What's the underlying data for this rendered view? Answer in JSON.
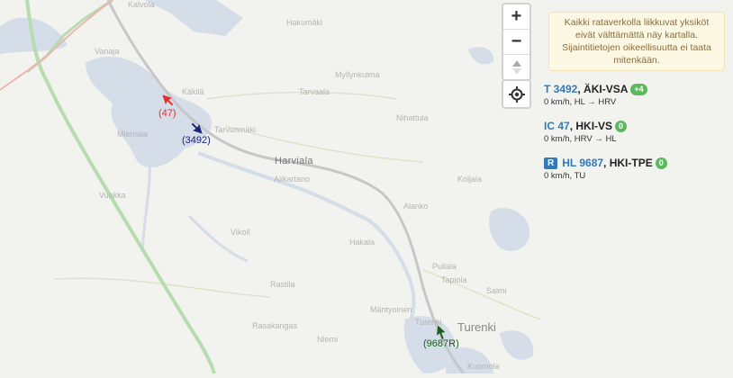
{
  "map": {
    "places": {
      "kalvola": "Kalvola",
      "hakumaki": "Hakumäki",
      "vanaja": "Vanaja",
      "mylly": "Myllynkulma",
      "kakila": "Käkilä",
      "tarvaala": "Tarvaala",
      "nihattula": "Nihattula",
      "miemala": "Miemala",
      "tarvunmaki": "Tarvunmäki",
      "harviala": "Harviala",
      "alikartano": "Alikartano",
      "koljala": "Koljala",
      "alanko": "Alanko",
      "pullala": "Pullala",
      "tapiola": "Tapiola",
      "rastila": "Rastila",
      "rasakangas": "Rasakangas",
      "mantyoinen": "Mäntyoinen",
      "turenki": "Turenki",
      "turenki_small": "Turenki",
      "kuomola": "Kuomola",
      "vikoll": "Vikoll",
      "hakala": "Hakala",
      "vuokka": "Vuokka",
      "salmi": "Salmi",
      "niemi": "Niemi"
    },
    "markers": [
      {
        "label": "(47)",
        "color": "#e03030"
      },
      {
        "label": "(3492)",
        "color": "#1a237e"
      },
      {
        "label": "(9687R)",
        "color": "#1b5e20"
      }
    ]
  },
  "controls": {
    "zoom_in": "+",
    "zoom_out": "−",
    "compass": "▲"
  },
  "notice": "Kaikki rataverkolla liikkuvat yksiköt eivät välttämättä näy kartalla. Sijaintitietojen oikeellisuutta ei taata mitenkään.",
  "trains": [
    {
      "id": "T 3492",
      "route": "ÄKI-VSA",
      "badge": "+4",
      "status": "0 km/h, HL → HRV"
    },
    {
      "id": "IC 47",
      "route": "HKI-VS",
      "badge": "0",
      "status": "0 km/h, HRV → HL"
    },
    {
      "prefix": "R",
      "id": "HL 9687",
      "route": "HKI-TPE",
      "badge": "0",
      "status": "0 km/h, TU"
    }
  ]
}
